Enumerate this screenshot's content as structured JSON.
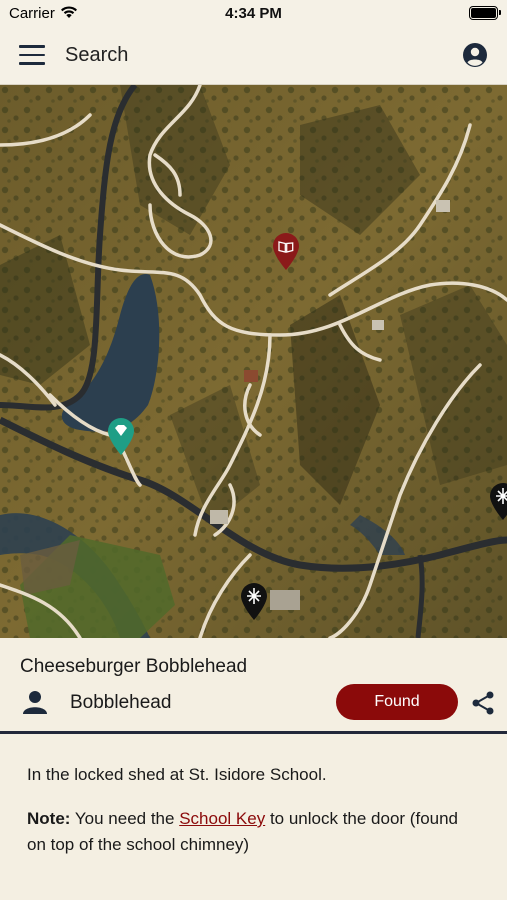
{
  "status_bar": {
    "carrier": "Carrier",
    "time": "4:34 PM"
  },
  "header": {
    "search_label": "Search"
  },
  "map": {
    "markers": [
      {
        "name": "book-marker-icon",
        "color": "#8b1a1a"
      },
      {
        "name": "gem-marker-icon",
        "color": "#1f9e86"
      },
      {
        "name": "bobblehead-marker-icon",
        "color": "#111111"
      },
      {
        "name": "bobblehead-marker-icon-edge",
        "color": "#111111"
      }
    ]
  },
  "item": {
    "title": "Cheeseburger Bobblehead",
    "category": "Bobblehead",
    "found_label": "Found"
  },
  "description": {
    "location": "In the locked shed at St. Isidore School.",
    "note_label": "Note:",
    "note_prefix": "You need the",
    "note_link": "School Key",
    "note_suffix": "to unlock the door (found on top of the school chimney)"
  },
  "colors": {
    "accent": "#8b0a0a",
    "background": "#f4efe2",
    "divider": "#22283a"
  }
}
